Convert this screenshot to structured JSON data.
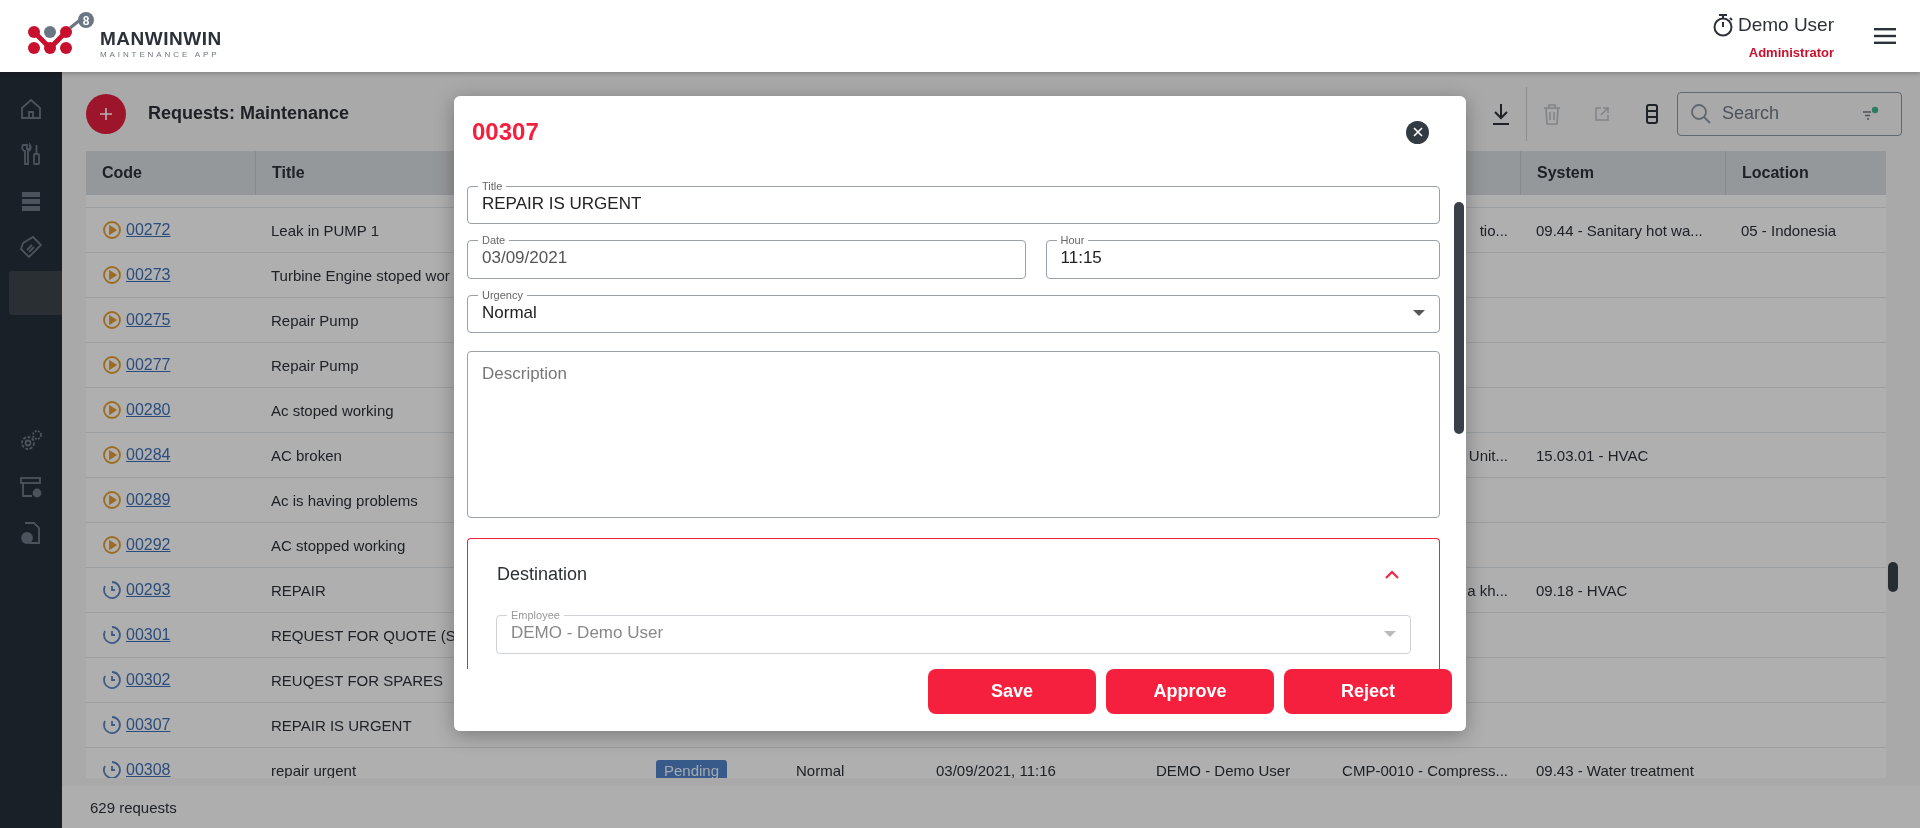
{
  "header": {
    "brand": "MANWINWIN",
    "tagline": "MAINTENANCE APP",
    "badge": "8",
    "user": "Demo User",
    "role": "Administrator"
  },
  "sidebar": {
    "items": [
      {
        "kind": "home",
        "selected": false
      },
      {
        "kind": "tools",
        "selected": false
      },
      {
        "kind": "stack",
        "selected": false
      },
      {
        "kind": "tag",
        "selected": false
      },
      {
        "kind": "blank",
        "selected": true
      },
      {
        "kind": "gears",
        "selected": false
      },
      {
        "kind": "archive",
        "selected": false
      },
      {
        "kind": "document",
        "selected": false
      }
    ]
  },
  "toolbar": {
    "title": "Requests: Maintenance",
    "actions": [
      {
        "kind": "download",
        "disabled": false
      },
      {
        "kind": "trash",
        "disabled": true
      },
      {
        "kind": "external",
        "disabled": true
      },
      {
        "kind": "columns",
        "disabled": false
      }
    ],
    "search": {
      "placeholder": "Search",
      "filter_active": true
    }
  },
  "table": {
    "columns": [
      "Code",
      "Title",
      "",
      "",
      "",
      "",
      "",
      "System",
      "Location"
    ],
    "rows": [
      {
        "kind": "play",
        "code": "00272",
        "title": "Leak in PUMP 1",
        "asset": "tio...",
        "system": "09.44 - Sanitary hot wa...",
        "location": "05 - Indonesia"
      },
      {
        "kind": "play",
        "code": "00273",
        "title": "Turbine Engine stoped wor"
      },
      {
        "kind": "play",
        "code": "00275",
        "title": "Repair Pump"
      },
      {
        "kind": "play",
        "code": "00277",
        "title": "Repair Pump"
      },
      {
        "kind": "play",
        "code": "00280",
        "title": "Ac stoped working"
      },
      {
        "kind": "play",
        "code": "00284",
        "title": "AC broken",
        "asset": "Unit...",
        "system": "15.03.01 - HVAC"
      },
      {
        "kind": "play",
        "code": "00289",
        "title": "Ac is having problems"
      },
      {
        "kind": "play",
        "code": "00292",
        "title": "AC stopped working"
      },
      {
        "kind": "clock",
        "code": "00293",
        "title": "REPAIR",
        "asset": "a kh...",
        "system": "09.18 - HVAC"
      },
      {
        "kind": "clock",
        "code": "00301",
        "title": "REQUEST FOR QUOTE (S"
      },
      {
        "kind": "clock",
        "code": "00302",
        "title": "REUQEST FOR SPARES"
      },
      {
        "kind": "clock",
        "code": "00307",
        "title": "REPAIR IS URGENT"
      },
      {
        "kind": "clock",
        "code": "00308",
        "title": "repair urgent",
        "status": "Pending",
        "urgency": "Normal",
        "date": "03/09/2021, 11:16",
        "employee": "DEMO - Demo User",
        "asset": "CMP-0010 - Compress...",
        "system": "09.43 - Water treatment"
      }
    ]
  },
  "status_bar": "629 requests",
  "dialog": {
    "title": "00307",
    "fields": [
      {
        "label": "Title",
        "value": "REPAIR IS URGENT"
      },
      {
        "label": "Date",
        "value": "03/09/2021"
      },
      {
        "label": "Hour",
        "value": "11:15"
      },
      {
        "label": "Urgency",
        "value": "Normal"
      }
    ],
    "description": {
      "placeholder": "Description"
    },
    "section": {
      "title": "Destination",
      "expanded": true,
      "field": {
        "label": "Employee",
        "value": "DEMO - Demo User",
        "disabled": true
      }
    },
    "buttons": [
      "Save",
      "Approve",
      "Reject"
    ]
  }
}
